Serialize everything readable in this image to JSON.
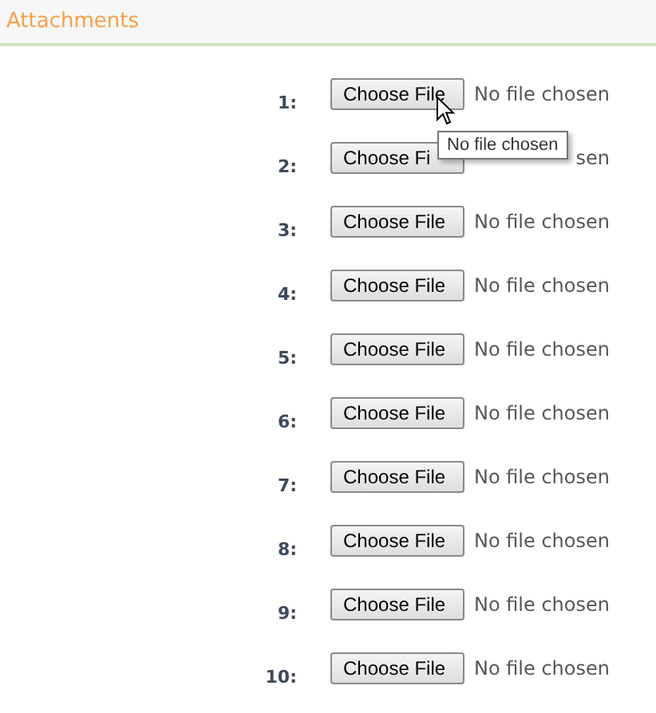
{
  "section": {
    "title": "Attachments"
  },
  "attachments": [
    {
      "label": "1:",
      "button": "Choose File",
      "status": "No file chosen"
    },
    {
      "label": "2:",
      "button": "Choose Fi",
      "status": "sen"
    },
    {
      "label": "3:",
      "button": "Choose File",
      "status": "No file chosen"
    },
    {
      "label": "4:",
      "button": "Choose File",
      "status": "No file chosen"
    },
    {
      "label": "5:",
      "button": "Choose File",
      "status": "No file chosen"
    },
    {
      "label": "6:",
      "button": "Choose File",
      "status": "No file chosen"
    },
    {
      "label": "7:",
      "button": "Choose File",
      "status": "No file chosen"
    },
    {
      "label": "8:",
      "button": "Choose File",
      "status": "No file chosen"
    },
    {
      "label": "9:",
      "button": "Choose File",
      "status": "No file chosen"
    },
    {
      "label": "10:",
      "button": "Choose File",
      "status": "No file chosen"
    }
  ],
  "tooltip": {
    "text": "No file chosen"
  }
}
